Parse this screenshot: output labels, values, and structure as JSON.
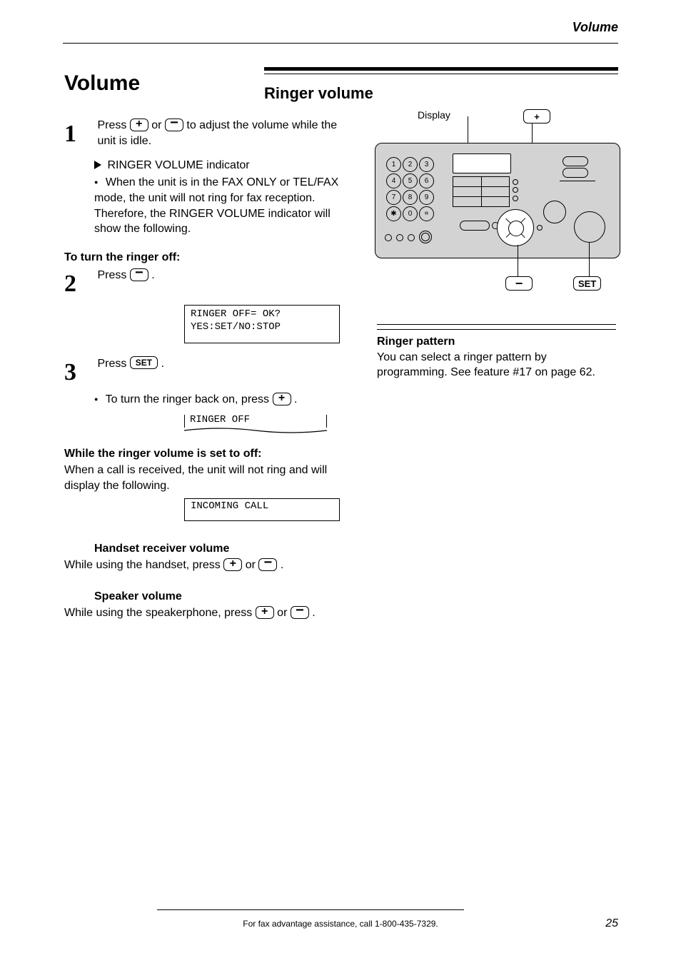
{
  "running_head": "Volume",
  "section_title": "Volume",
  "subtitle": "Ringer volume",
  "steps": {
    "s1": {
      "num": "1",
      "text_a": "Press ",
      "text_b": " or ",
      "text_c": " to adjust the volume while the unit is idle.",
      "sub_a": "RINGER VOLUME indicator",
      "sub_b": "When the unit is in the FAX ONLY or TEL/FAX mode, the unit will not ring for fax reception. Therefore, the RINGER VOLUME indicator will show the following."
    },
    "s2": {
      "num": "2",
      "line1_a": "Press ",
      "line1_b": "."
    },
    "s3": {
      "num": "3",
      "text_a": "Press ",
      "text_b": ".",
      "bullet": "To turn the ringer back on, press ",
      "bullet_end": "."
    }
  },
  "lcds": {
    "off_prompt": "RINGER OFF= OK?\nYES:SET/NO:STOP",
    "off_set": "RINGER OFF",
    "incoming": "INCOMING CALL"
  },
  "off_heading": "To turn the ringer off:",
  "while_off_heading": "While the ringer volume is set to off:",
  "while_off_text": "When a call is received, the unit will not ring and will display the following.",
  "other_volumes": {
    "handset": {
      "title": "Handset receiver volume",
      "body_a": "While using the handset, press ",
      "body_b": " or ",
      "body_c": "."
    },
    "speaker": {
      "title": "Speaker volume",
      "body_a": "While using the speakerphone, press ",
      "body_b": " or ",
      "body_c": "."
    }
  },
  "btn_labels": {
    "set": "SET"
  },
  "panel_callouts": {
    "display": "Display",
    "set": "SET"
  },
  "note": {
    "heading": "Ringer pattern",
    "body": "You can select a ringer pattern by programming. See feature #17 on page 62."
  },
  "footer": "For fax advantage assistance, call 1-800-435-7329.",
  "page_number": "25"
}
